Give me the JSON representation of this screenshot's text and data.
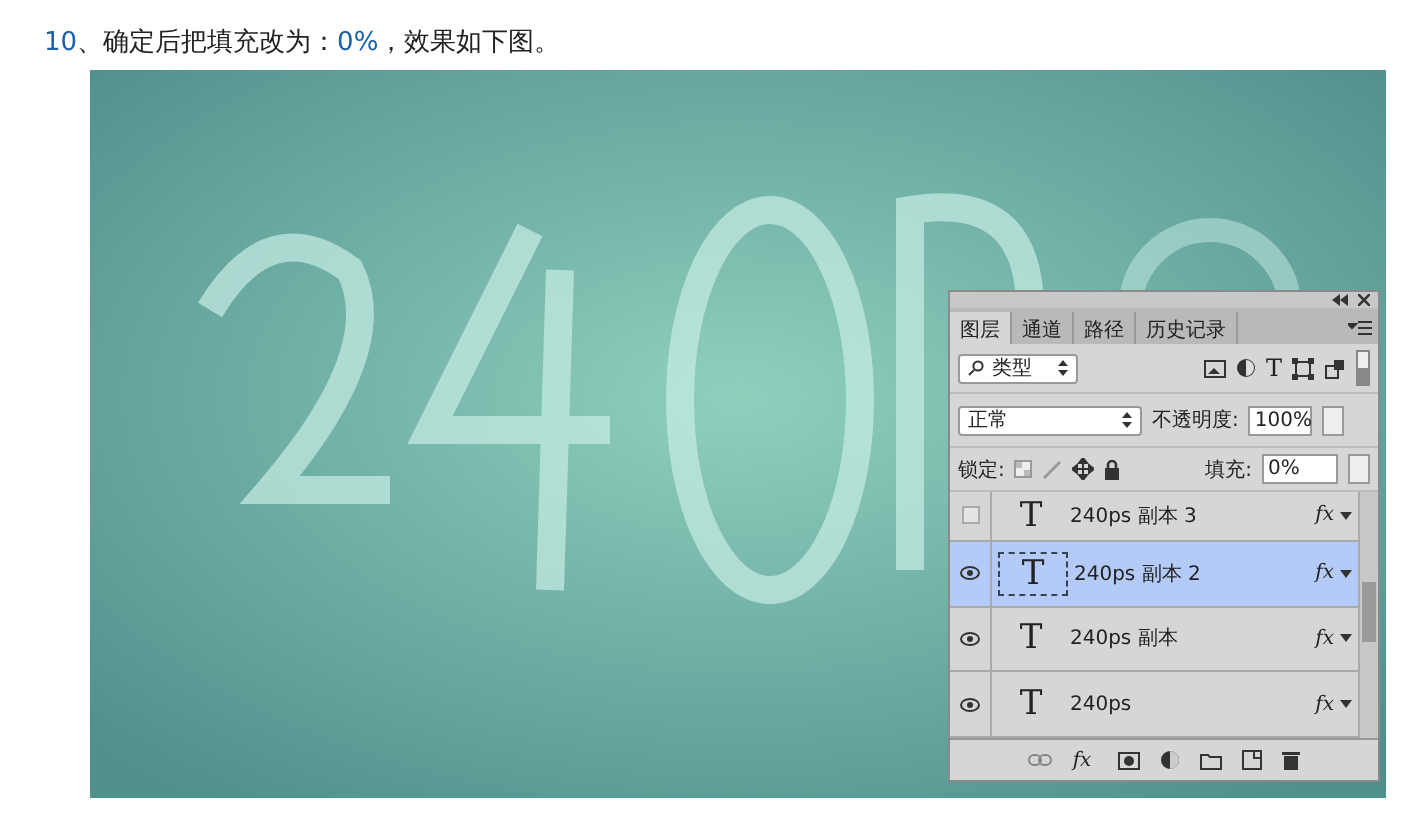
{
  "heading": {
    "number": "10",
    "text": "、确定后把填充改为：",
    "value": "0%",
    "tail": "，效果如下图。"
  },
  "panel": {
    "tabs": [
      {
        "label": "图层",
        "selected": true
      },
      {
        "label": "通道",
        "selected": false
      },
      {
        "label": "路径",
        "selected": false
      },
      {
        "label": "历史记录",
        "selected": false
      }
    ],
    "filter": {
      "value": "类型",
      "text_glyph": "T"
    },
    "blend": {
      "value": "正常",
      "opacity_label": "不透明度:",
      "opacity": "100%"
    },
    "lock": {
      "label": "锁定:",
      "fill_label": "填充:",
      "fill": "0%"
    },
    "layers": [
      {
        "name": "240ps 副本 3",
        "thumb": "T",
        "fx": "fx",
        "visible": false,
        "selected": false
      },
      {
        "name": "240ps 副本 2",
        "thumb": "T",
        "fx": "fx",
        "visible": true,
        "selected": true
      },
      {
        "name": "240ps 副本",
        "thumb": "T",
        "fx": "fx",
        "visible": true,
        "selected": false
      },
      {
        "name": "240ps",
        "thumb": "T",
        "fx": "fx",
        "visible": true,
        "selected": false
      }
    ],
    "footer_fx": "fx"
  }
}
